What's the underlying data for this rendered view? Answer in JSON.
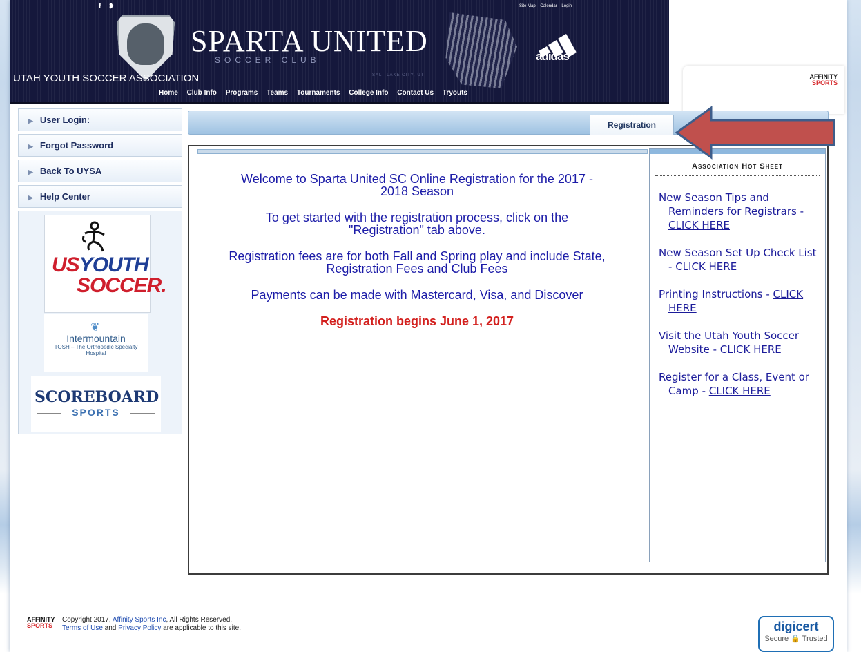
{
  "header": {
    "social_icons": "f ❥",
    "top_links": [
      "Site Map",
      "Calendar",
      "Login"
    ],
    "club_title": "SPARTA UNITED",
    "club_subtitle": "SOCCER CLUB",
    "city": "SALT LAKE CITY, UT",
    "sponsor_brand": "adidas",
    "association": "UTAH YOUTH SOCCER ASSOCIATION",
    "nav": [
      "Home",
      "Club Info",
      "Programs",
      "Teams",
      "Tournaments",
      "College Info",
      "Contact Us",
      "Tryouts"
    ],
    "affinity_logo": {
      "line1": "AFFINITY",
      "line2": "SPORTS"
    }
  },
  "sidebar": {
    "items": [
      {
        "label": "User Login:"
      },
      {
        "label": "Forgot Password"
      },
      {
        "label": "Back To UYSA"
      },
      {
        "label": "Help Center"
      }
    ],
    "sponsors": {
      "usys": {
        "line1": "US",
        "line2": "YOUTH",
        "line3": "SOCCER."
      },
      "intermountain": {
        "name": "Intermountain",
        "sub": "TOSH – The Orthopedic Specialty Hospital"
      },
      "scoreboard": {
        "line1": "SCOREBOARD",
        "line2": "SPORTS"
      }
    }
  },
  "tabs": [
    {
      "label": "Registration",
      "active": true
    }
  ],
  "main": {
    "welcome": "Welcome to Sparta United SC Online Registration for the 2017 - 2018 Season",
    "get_started": "To get started with the registration process, click on the \"Registration\" tab above.",
    "fees": "Registration fees are for both Fall and Spring play and include State, Registration Fees and Club Fees",
    "payments": "Payments can be made with Mastercard, Visa, and Discover",
    "begins": "Registration begins June 1, 2017"
  },
  "hot_sheet": {
    "title": "Association Hot Sheet",
    "items": [
      {
        "text": "New Season Tips and Reminders for Registrars - ",
        "link": "CLICK HERE"
      },
      {
        "text": "New Season Set Up Check List - ",
        "link": "CLICK HERE"
      },
      {
        "text": "Printing Instructions - ",
        "link": "CLICK HERE"
      },
      {
        "text": "Visit the Utah Youth Soccer Website - ",
        "link": "CLICK HERE"
      },
      {
        "text": "Register for a Class, Event or Camp - ",
        "link": "CLICK HERE"
      }
    ]
  },
  "footer": {
    "copyright_prefix": "Copyright 2017, ",
    "company_link": "Affinity Sports Inc",
    "copyright_suffix": ", All Rights Reserved.",
    "terms_link": "Terms of Use",
    "and": " and ",
    "privacy_link": "Privacy Policy",
    "terms_suffix": " are applicable to this site.",
    "logo": {
      "line1": "AFFINITY",
      "line2": "SPORTS"
    },
    "digicert": {
      "name": "digicert",
      "sub": "Secure 🔒 Trusted"
    }
  },
  "colors": {
    "banner": "#15183c",
    "link_blue": "#1c1c9a",
    "alert_red": "#d3201e",
    "annotation_arrow": "#c0504d"
  }
}
